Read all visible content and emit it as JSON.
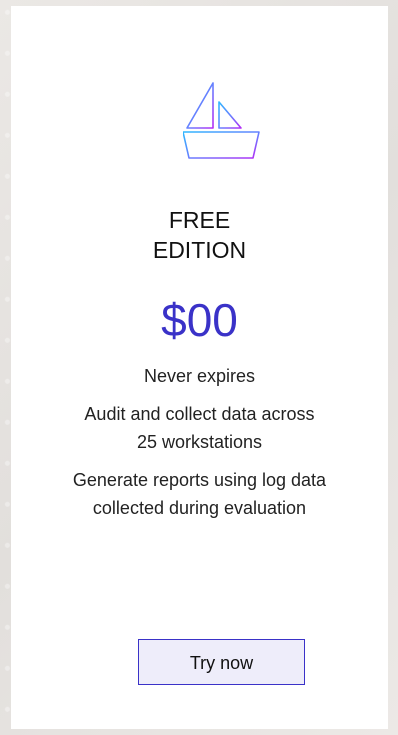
{
  "plan": {
    "edition_line1": "FREE",
    "edition_line2": "EDITION",
    "price": "$00",
    "features": [
      "Never expires",
      "Audit and collect data across 25 workstations",
      "Generate reports using log data collected during evaluation"
    ],
    "cta_label": "Try now"
  },
  "icons": {
    "plan_logo": "sailboat-icon"
  },
  "colors": {
    "accent": "#3a32c8",
    "button_bg": "#eeedfa",
    "icon_gradient_start": "#2fb8ff",
    "icon_gradient_end": "#b42cf5"
  }
}
